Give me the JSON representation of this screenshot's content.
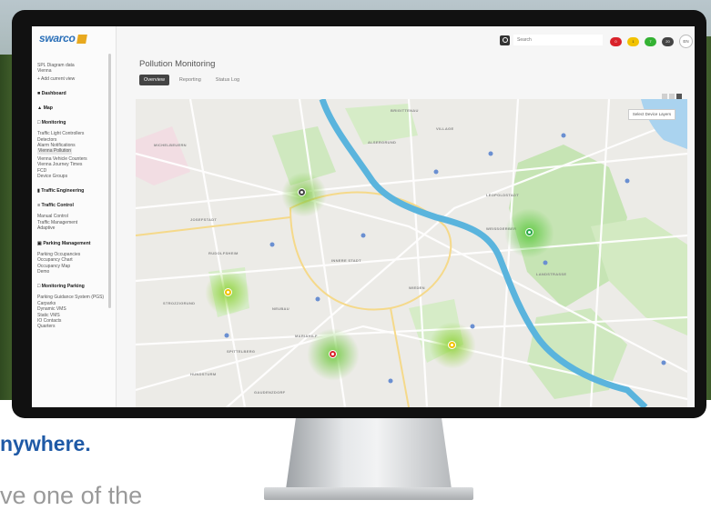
{
  "marketing": {
    "headline": "nywhere.",
    "subline": "ve one of the"
  },
  "app": {
    "brand": "swarco",
    "search": {
      "placeholder": "Search"
    },
    "status_badges": [
      {
        "label": "0",
        "color": "#d9222b"
      },
      {
        "label": "1",
        "color": "#f2c200"
      },
      {
        "label": "7",
        "color": "#34b233"
      },
      {
        "label": "20",
        "color": "#444444"
      }
    ],
    "language": "EN",
    "sidebar": {
      "top_items": [
        "SPL Diagram data",
        "Vienna",
        "+ Add current view"
      ],
      "sections": [
        {
          "title": "Dashboard",
          "items": []
        },
        {
          "title": "Map",
          "items": []
        },
        {
          "title": "Monitoring",
          "items": [
            "Traffic Light Controllers",
            "Detectors",
            "Alarm Notifications",
            "Vienna Pollution",
            "Vienna Vehicle Counters",
            "Vienna Journey Times",
            "FCD",
            "Device Groups"
          ]
        },
        {
          "title": "Traffic Engineering",
          "items": []
        },
        {
          "title": "Traffic Control",
          "items": [
            "Manual Control",
            "Traffic Management",
            "Adaptive"
          ]
        },
        {
          "title": "Parking Management",
          "items": [
            "Parking Occupancies",
            "Occupancy Chart",
            "Occupancy Map",
            "Demo"
          ]
        },
        {
          "title": "Monitoring Parking",
          "items": [
            "Parking Guidance System (PGS)",
            "Carparks",
            "Dynamic VMS",
            "Static VMS",
            "IO Contacts",
            "Quarters"
          ]
        }
      ],
      "active_item": "Vienna Pollution"
    },
    "page_title": "Pollution Monitoring",
    "tabs": [
      "Overview",
      "Reporting",
      "Status Log"
    ],
    "active_tab": "Overview",
    "map": {
      "layer_button": "Select Device Layers",
      "districts": [
        "MICHELBEUERN",
        "ALSERGRUND",
        "JOSEFSTADT",
        "INNERE STADT",
        "LEOPOLDSTADT",
        "NEUBAU",
        "MARIAHILF",
        "WIEDEN",
        "LANDSTRASSE",
        "RUDOLFSHEIM",
        "STROZZIGRUND",
        "SPITTELBERG",
        "WEISSGERBER",
        "HUNDSTURM",
        "GAUDENZDORF",
        "BRIGITTENAU",
        "VILLAGE"
      ],
      "sensors": [
        {
          "name": "pollution-sensor-alsergrund",
          "status": "good",
          "color": "#ffffff"
        },
        {
          "name": "pollution-sensor-leopoldstadt",
          "status": "good",
          "color": "#2ba84a"
        },
        {
          "name": "pollution-sensor-rudolfsheim",
          "status": "moderate",
          "color": "#f2c200"
        },
        {
          "name": "pollution-sensor-mariahilf",
          "status": "bad",
          "color": "#d9222b"
        },
        {
          "name": "pollution-sensor-wieden",
          "status": "moderate",
          "color": "#f2c200"
        }
      ]
    }
  }
}
